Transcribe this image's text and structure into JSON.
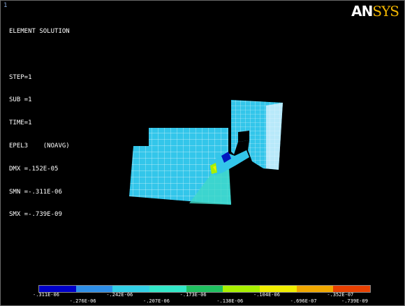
{
  "window": {
    "number": "1"
  },
  "logo": {
    "an": "AN",
    "sys": "SYS"
  },
  "info": {
    "lines": [
      "ELEMENT SOLUTION",
      "",
      "STEP=1",
      "SUB =1",
      "TIME=1",
      "EPEL3    (NOAVG)",
      "DMX =.152E-05",
      "SMN =-.311E-06",
      "SMX =-.739E-09"
    ]
  },
  "legend": {
    "colors": [
      "#0000c8",
      "#2f8fe8",
      "#33d0e6",
      "#33e8c8",
      "#20c060",
      "#a8f000",
      "#f0ee00",
      "#f0a800",
      "#e84000"
    ],
    "top_labels": [
      "-.311E-06",
      "-.242E-06",
      "-.173E-06",
      "-.104E-06",
      "-.352E-07"
    ],
    "bottom_labels": [
      "-.276E-06",
      "-.207E-06",
      "-.138E-06",
      "-.696E-07",
      "-.739E-09"
    ]
  }
}
